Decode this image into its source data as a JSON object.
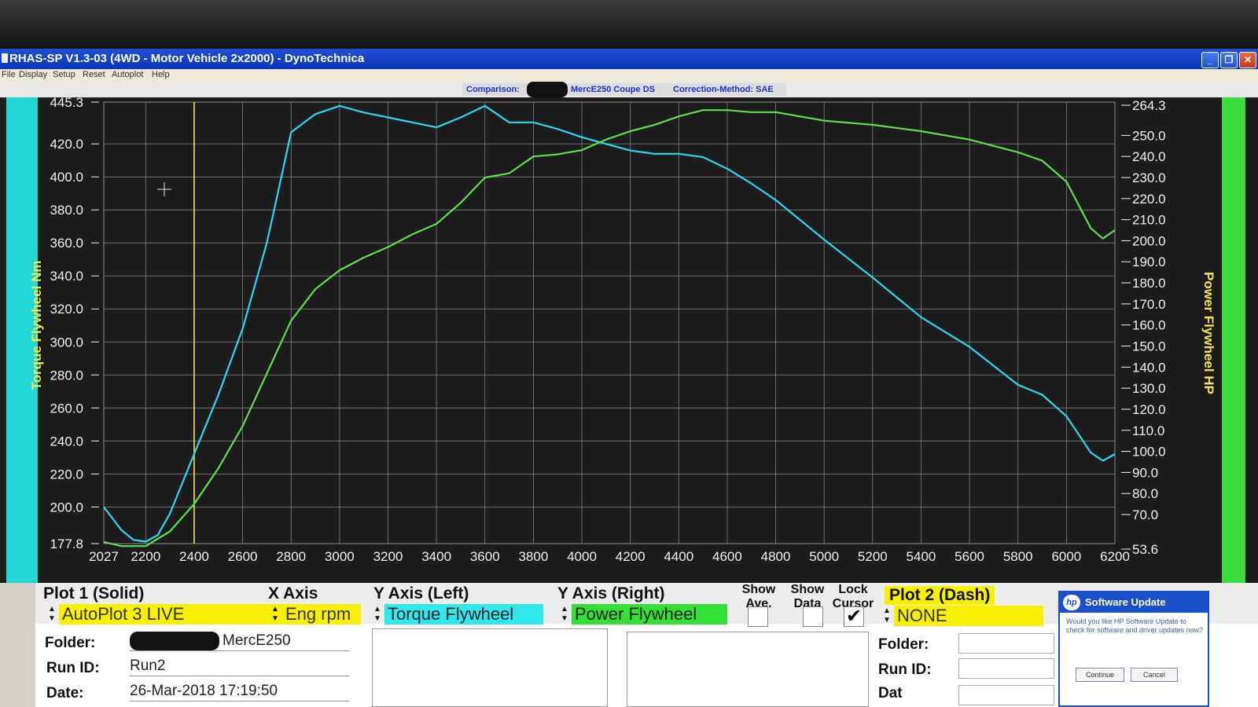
{
  "window": {
    "title": "RHAS-SP V1.3-03  (4WD - Motor Vehicle 2x2000) - DynoTechnica",
    "min_label": "_",
    "max_label": "❐",
    "close_label": "✕"
  },
  "menu": [
    "File",
    "Display",
    "Setup",
    "Reset",
    "Autoplot",
    "Help"
  ],
  "comparison": {
    "label": "Comparison:",
    "vehicle": "MercE250 Coupe DS",
    "correction": "Correction-Method: SAE"
  },
  "chart_data": {
    "type": "line",
    "xlabel": "",
    "ylabel": "Torque Flywheel Nm",
    "y2label": "Power Flywheel HP",
    "xlim": [
      2027,
      6200
    ],
    "ylim": [
      177.8,
      445.3
    ],
    "y2lim": [
      53.6,
      264.3
    ],
    "x_ticks": [
      "2027",
      "2200",
      "2400",
      "2600",
      "2800",
      "3000",
      "3200",
      "3400",
      "3600",
      "3800",
      "4000",
      "4200",
      "4400",
      "4600",
      "4800",
      "5000",
      "5200",
      "5400",
      "5600",
      "5800",
      "6000",
      "6200"
    ],
    "y_ticks": [
      "445.3",
      "420.0",
      "400.0",
      "380.0",
      "360.0",
      "340.0",
      "320.0",
      "300.0",
      "280.0",
      "260.0",
      "240.0",
      "220.0",
      "200.0",
      "177.8"
    ],
    "y2_ticks": [
      "264.3",
      "250.0",
      "240.0",
      "230.0",
      "220.0",
      "210.0",
      "200.0",
      "190.0",
      "180.0",
      "170.0",
      "160.0",
      "150.0",
      "140.0",
      "130.0",
      "120.0",
      "110.0",
      "100.0",
      "90.0",
      "80.0",
      "70.0",
      "53.6"
    ],
    "grid": true,
    "cursor_x": 2400,
    "series": [
      {
        "name": "Torque Flywheel",
        "axis": "left",
        "color": "#2ad8f0",
        "x": [
          2027,
          2100,
          2150,
          2200,
          2250,
          2300,
          2400,
          2500,
          2600,
          2700,
          2760,
          2800,
          2900,
          3000,
          3100,
          3200,
          3300,
          3400,
          3500,
          3600,
          3700,
          3800,
          3900,
          4000,
          4100,
          4200,
          4300,
          4400,
          4500,
          4600,
          4700,
          4800,
          5000,
          5200,
          5400,
          5600,
          5800,
          5900,
          6000,
          6100,
          6150,
          6200
        ],
        "y": [
          200,
          186,
          180,
          179,
          183,
          196,
          232,
          268,
          308,
          360,
          400,
          427,
          438,
          443,
          439,
          436,
          433,
          430,
          436,
          443,
          433,
          433,
          429,
          424,
          420,
          416,
          414,
          414,
          412,
          405,
          396,
          386,
          362,
          339,
          315,
          297,
          274,
          268,
          255,
          233,
          228,
          232
        ]
      },
      {
        "name": "Power Flywheel",
        "axis": "right",
        "color": "#5ee04a",
        "x": [
          2027,
          2100,
          2200,
          2300,
          2400,
          2500,
          2600,
          2700,
          2800,
          2900,
          3000,
          3100,
          3200,
          3300,
          3400,
          3500,
          3600,
          3700,
          3800,
          3900,
          4000,
          4100,
          4200,
          4300,
          4400,
          4500,
          4600,
          4700,
          4800,
          4900,
          5000,
          5200,
          5400,
          5600,
          5800,
          5900,
          6000,
          6100,
          6150,
          6200
        ],
        "y": [
          57,
          55,
          55,
          62,
          75,
          92,
          112,
          137,
          162,
          177,
          186,
          192,
          197,
          203,
          208,
          218,
          230,
          232,
          240,
          241,
          243,
          248,
          252,
          255,
          259,
          262,
          262,
          261,
          261,
          259,
          257,
          255,
          252,
          248,
          242,
          238,
          228,
          206,
          201,
          205
        ]
      }
    ]
  },
  "controls": {
    "plot1": {
      "title": "Plot 1 (Solid)",
      "value": "AutoPlot 3 LIVE"
    },
    "xaxis": {
      "title": "X Axis",
      "value": "Eng rpm"
    },
    "yleft": {
      "title": "Y Axis (Left)",
      "value": "Torque Flywheel"
    },
    "yright": {
      "title": "Y Axis (Right)",
      "value": "Power Flywheel"
    },
    "show_ave": {
      "line1": "Show",
      "line2": "Ave.",
      "checked": false
    },
    "show_data": {
      "line1": "Show",
      "line2": "Data",
      "checked": false
    },
    "lock_cursor": {
      "line1": "Lock",
      "line2": "Cursor",
      "checked": true,
      "mark": "✔"
    },
    "plot2": {
      "title": "Plot 2 (Dash)",
      "value": "NONE"
    },
    "folder_label": "Folder:",
    "folder_value": "MercE250",
    "runid_label": "Run ID:",
    "runid_value": "Run2",
    "date_label": "Date:",
    "date_value": "26-Mar-2018  17:19:50",
    "folder2_label": "Folder:",
    "runid2_label": "Run ID:",
    "date2_label": "Dat"
  },
  "hp_popup": {
    "title": "Software Update",
    "logo": "hp",
    "message": "Would you like HP Software Update to check for software and driver updates now?",
    "continue_label": "Continue",
    "cancel_label": "Cancel"
  }
}
